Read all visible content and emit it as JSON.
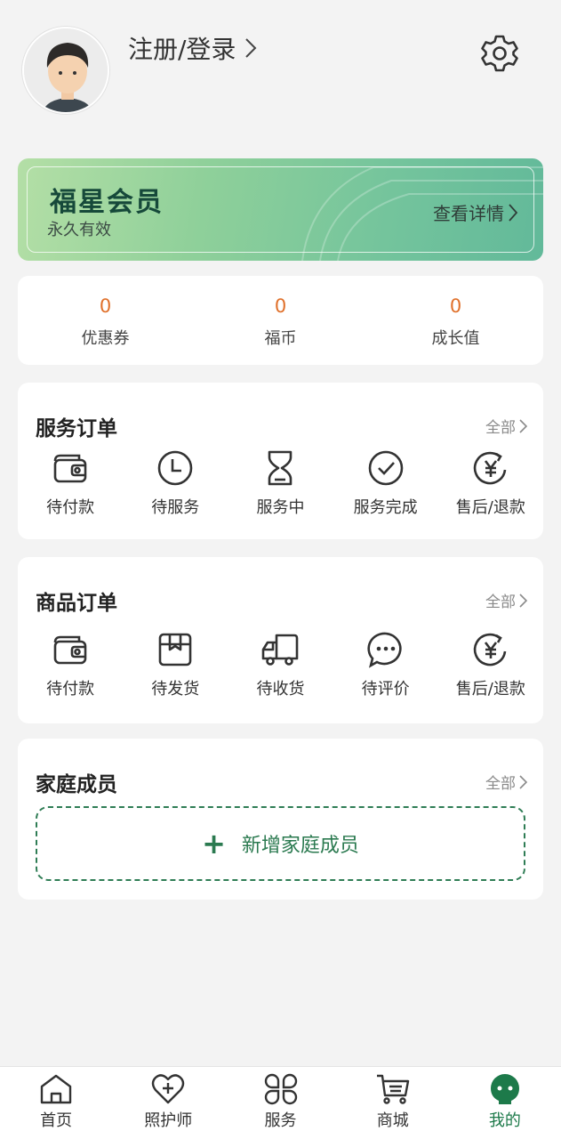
{
  "header": {
    "login_label": "注册/登录",
    "avatar_icon": "user-avatar",
    "settings_icon": "gear-icon"
  },
  "member": {
    "title": "福星会员",
    "validity": "永久有效",
    "detail_label": "查看详情"
  },
  "stats": [
    {
      "value": "0",
      "label": "优惠券"
    },
    {
      "value": "0",
      "label": "福币"
    },
    {
      "value": "0",
      "label": "成长值"
    }
  ],
  "service_orders": {
    "title": "服务订单",
    "all_label": "全部",
    "items": [
      {
        "label": "待付款",
        "icon": "wallet-icon"
      },
      {
        "label": "待服务",
        "icon": "clock-icon"
      },
      {
        "label": "服务中",
        "icon": "hourglass-icon"
      },
      {
        "label": "服务完成",
        "icon": "check-circle-icon"
      },
      {
        "label": "售后/退款",
        "icon": "refund-icon"
      }
    ]
  },
  "goods_orders": {
    "title": "商品订单",
    "all_label": "全部",
    "items": [
      {
        "label": "待付款",
        "icon": "wallet-icon"
      },
      {
        "label": "待发货",
        "icon": "package-icon"
      },
      {
        "label": "待收货",
        "icon": "truck-icon"
      },
      {
        "label": "待评价",
        "icon": "chat-icon"
      },
      {
        "label": "售后/退款",
        "icon": "refund-icon"
      }
    ]
  },
  "family": {
    "title": "家庭成员",
    "all_label": "全部",
    "add_label": "新增家庭成员"
  },
  "tabbar": [
    {
      "label": "首页",
      "icon": "home-icon"
    },
    {
      "label": "照护师",
      "icon": "heart-plus-icon"
    },
    {
      "label": "服务",
      "icon": "grid-icon"
    },
    {
      "label": "商城",
      "icon": "cart-icon"
    },
    {
      "label": "我的",
      "icon": "profile-icon",
      "active": true
    }
  ],
  "colors": {
    "accent": "#1d7a4a",
    "stat_value": "#e0702a",
    "background": "#f3f3f3"
  }
}
